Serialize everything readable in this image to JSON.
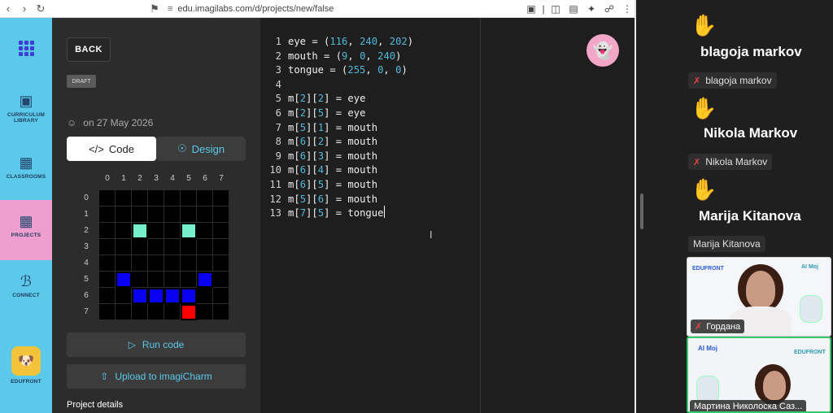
{
  "browser": {
    "url": "edu.imagilabs.com/d/projects/new/false"
  },
  "sidebar": {
    "items": [
      {
        "label": "CURRICULUM LIBRARY"
      },
      {
        "label": "CLASSROOMS"
      },
      {
        "label": "PROJECTS"
      },
      {
        "label": "CONNECT"
      },
      {
        "label": "EDUFRONT"
      }
    ]
  },
  "panel": {
    "back_label": "BACK",
    "draft_label": "DRAFT",
    "date": "on 27 May 2026",
    "tab_code": "Code",
    "tab_design": "Design",
    "matrix": {
      "col_labels": [
        "0",
        "1",
        "2",
        "3",
        "4",
        "5",
        "6",
        "7"
      ],
      "row_labels": [
        "0",
        "1",
        "2",
        "3",
        "4",
        "5",
        "6",
        "7"
      ],
      "cells": [
        {
          "row": 2,
          "col": 2,
          "color": "#74F0CA"
        },
        {
          "row": 2,
          "col": 5,
          "color": "#74F0CA"
        },
        {
          "row": 5,
          "col": 1,
          "color": "#0900F0"
        },
        {
          "row": 6,
          "col": 2,
          "color": "#0900F0"
        },
        {
          "row": 6,
          "col": 3,
          "color": "#0900F0"
        },
        {
          "row": 6,
          "col": 4,
          "color": "#0900F0"
        },
        {
          "row": 6,
          "col": 5,
          "color": "#0900F0"
        },
        {
          "row": 5,
          "col": 6,
          "color": "#0900F0"
        },
        {
          "row": 7,
          "col": 5,
          "color": "#FF0000"
        }
      ]
    },
    "run_label": "Run code",
    "upload_label": "Upload to imagiCharm",
    "project_details": "Project details"
  },
  "editor": {
    "lines": [
      {
        "n": "1",
        "code": "eye = (116, 240, 202)"
      },
      {
        "n": "2",
        "code": "mouth = (9, 0, 240)"
      },
      {
        "n": "3",
        "code": "tongue = (255, 0, 0)"
      },
      {
        "n": "4",
        "code": ""
      },
      {
        "n": "5",
        "code": "m[2][2] = eye"
      },
      {
        "n": "6",
        "code": "m[2][5] = eye"
      },
      {
        "n": "7",
        "code": "m[5][1] = mouth"
      },
      {
        "n": "8",
        "code": "m[6][2] = mouth"
      },
      {
        "n": "9",
        "code": "m[6][3] = mouth"
      },
      {
        "n": "10",
        "code": "m[6][4] = mouth"
      },
      {
        "n": "11",
        "code": "m[6][5] = mouth"
      },
      {
        "n": "12",
        "code": "m[5][6] = mouth"
      },
      {
        "n": "13",
        "code": "m[7][5] = tongue"
      }
    ]
  },
  "meeting": {
    "raised_hands": [
      {
        "name": "blagoja markov",
        "tag": "blagoja markov"
      },
      {
        "name": "Nikola Markov",
        "tag": "Nikola Markov"
      },
      {
        "name": "Marija Kitanova",
        "tag": "Marija Kitanova"
      }
    ],
    "videos": [
      {
        "name": "Гордана",
        "brand_left": "EDUFRONT",
        "brand_right": "AI Мој"
      },
      {
        "name": "Мартина Николоска Саз...",
        "brand_left": "AI Мој",
        "brand_right": "EDUFRONT"
      }
    ]
  },
  "colors": {
    "sidebar": "#5cc8ea",
    "sidebar_active": "#ee9fd0",
    "accent": "#5cc8ea",
    "hand": "#f6c542",
    "speaking_border": "#36c86b"
  }
}
